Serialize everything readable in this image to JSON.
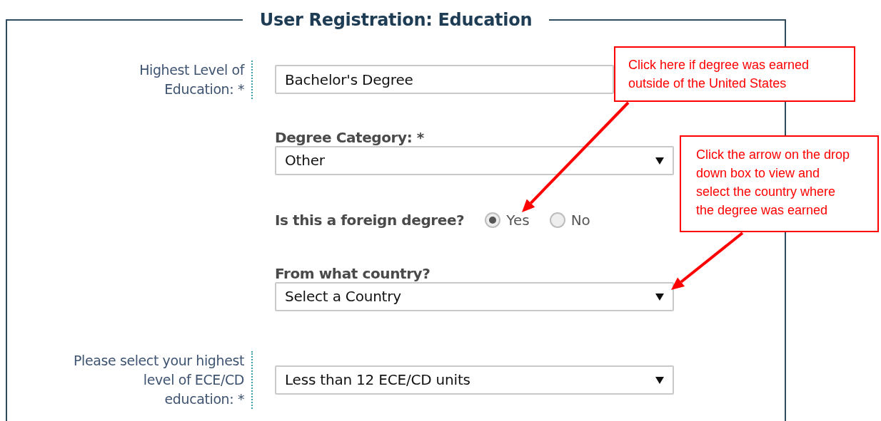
{
  "form": {
    "title": "User Registration: Education",
    "fields": [
      {
        "kind": "side",
        "label_lines": [
          "Highest Level of",
          "Education: *"
        ],
        "value": "Bachelor's Degree",
        "caret": false
      },
      {
        "kind": "stacked",
        "label": "Degree Category: *",
        "value": "Other",
        "caret": true
      },
      {
        "kind": "radio",
        "label": "Is this a foreign degree?",
        "options": [
          {
            "label": "Yes",
            "selected": true
          },
          {
            "label": "No",
            "selected": false
          }
        ]
      },
      {
        "kind": "stacked",
        "label": "From what country?",
        "value": "Select a Country",
        "caret": true
      },
      {
        "kind": "side",
        "label_lines": [
          "Please select your highest",
          "level of ECE/CD",
          "education: *"
        ],
        "value": "Less than 12 ECE/CD units",
        "caret": true
      }
    ]
  },
  "callouts": [
    {
      "lines": [
        "Click here if degree was earned",
        "outside of the United States"
      ]
    },
    {
      "lines": [
        "Click the arrow on the drop",
        "down box to view and",
        "select the country where",
        "the degree was earned"
      ]
    }
  ]
}
